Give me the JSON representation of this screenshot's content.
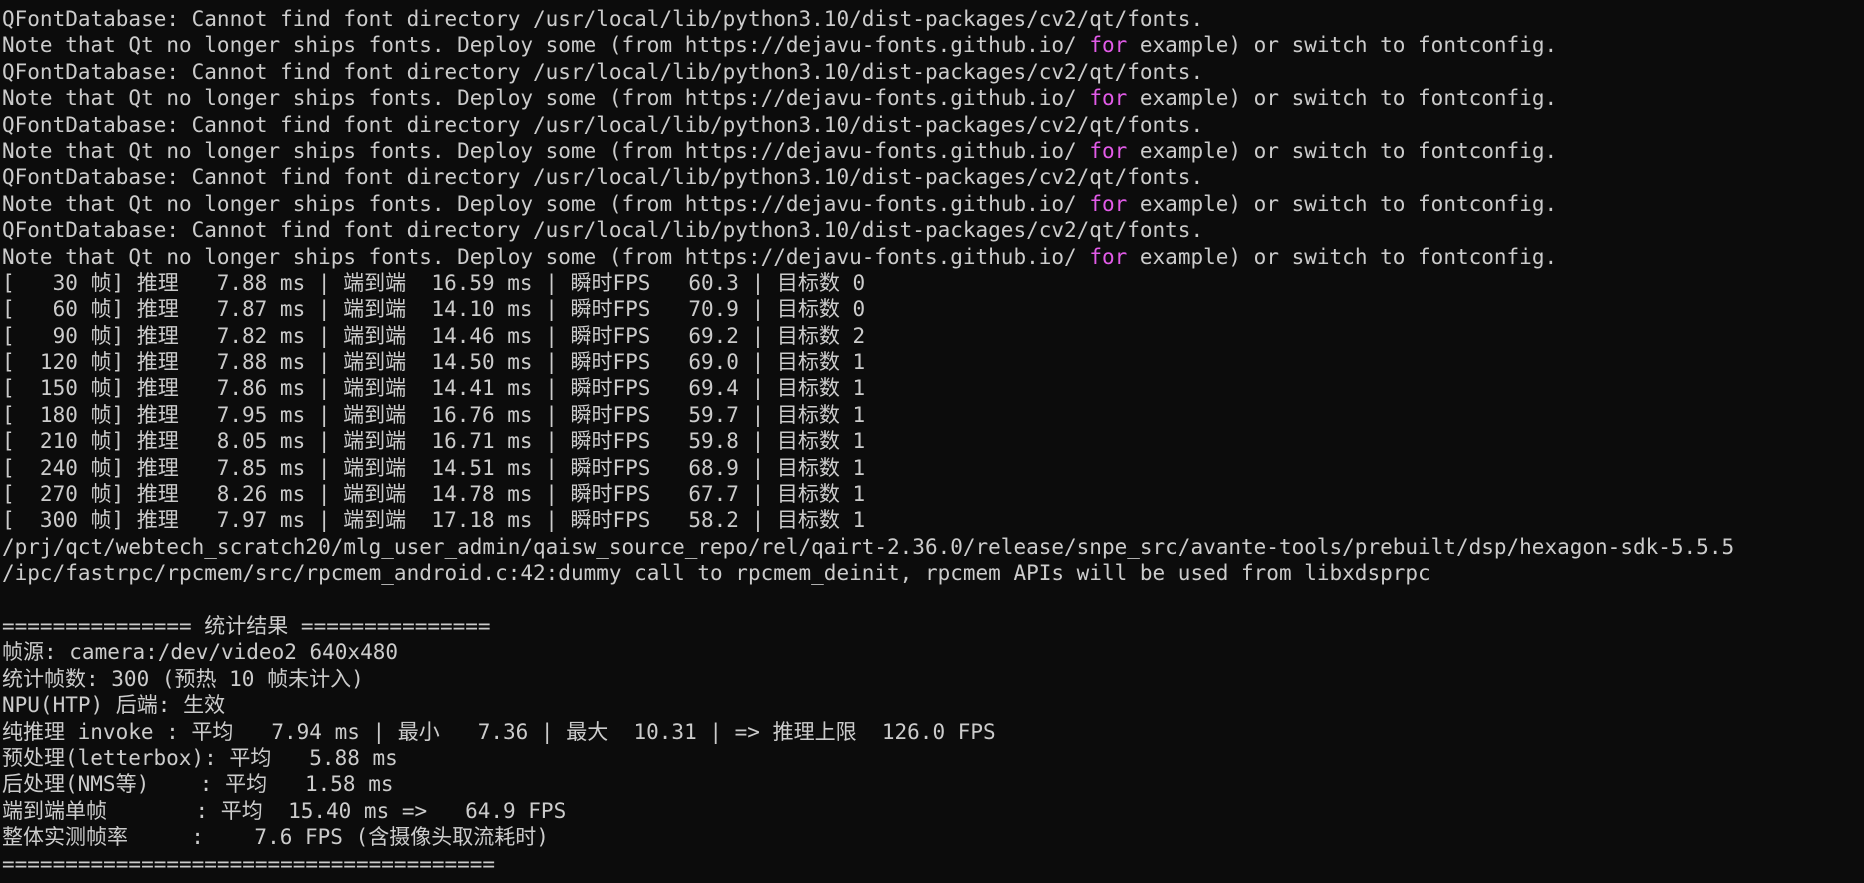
{
  "colors": {
    "background": "#0c0c0c",
    "foreground": "#cccccc",
    "keyword": "#e25be8"
  },
  "lines": [
    [
      {
        "t": "QFontDatabase: Cannot find font directory /usr/local/lib/python3.10/dist-packages/cv2/qt/fonts."
      }
    ],
    [
      {
        "t": "Note that Qt no longer ships fonts. Deploy some (from https://dejavu-fonts.github.io/ "
      },
      {
        "t": "for",
        "c": "kw"
      },
      {
        "t": " example) or switch to fontconfig."
      }
    ],
    [
      {
        "t": "QFontDatabase: Cannot find font directory /usr/local/lib/python3.10/dist-packages/cv2/qt/fonts."
      }
    ],
    [
      {
        "t": "Note that Qt no longer ships fonts. Deploy some (from https://dejavu-fonts.github.io/ "
      },
      {
        "t": "for",
        "c": "kw"
      },
      {
        "t": " example) or switch to fontconfig."
      }
    ],
    [
      {
        "t": "QFontDatabase: Cannot find font directory /usr/local/lib/python3.10/dist-packages/cv2/qt/fonts."
      }
    ],
    [
      {
        "t": "Note that Qt no longer ships fonts. Deploy some (from https://dejavu-fonts.github.io/ "
      },
      {
        "t": "for",
        "c": "kw"
      },
      {
        "t": " example) or switch to fontconfig."
      }
    ],
    [
      {
        "t": "QFontDatabase: Cannot find font directory /usr/local/lib/python3.10/dist-packages/cv2/qt/fonts."
      }
    ],
    [
      {
        "t": "Note that Qt no longer ships fonts. Deploy some (from https://dejavu-fonts.github.io/ "
      },
      {
        "t": "for",
        "c": "kw"
      },
      {
        "t": " example) or switch to fontconfig."
      }
    ],
    [
      {
        "t": "QFontDatabase: Cannot find font directory /usr/local/lib/python3.10/dist-packages/cv2/qt/fonts."
      }
    ],
    [
      {
        "t": "Note that Qt no longer ships fonts. Deploy some (from https://dejavu-fonts.github.io/ "
      },
      {
        "t": "for",
        "c": "kw"
      },
      {
        "t": " example) or switch to fontconfig."
      }
    ],
    [
      {
        "t": "[   30 帧] 推理   7.88 ms | 端到端  16.59 ms | 瞬时FPS   60.3 | 目标数 0"
      }
    ],
    [
      {
        "t": "[   60 帧] 推理   7.87 ms | 端到端  14.10 ms | 瞬时FPS   70.9 | 目标数 0"
      }
    ],
    [
      {
        "t": "[   90 帧] 推理   7.82 ms | 端到端  14.46 ms | 瞬时FPS   69.2 | 目标数 2"
      }
    ],
    [
      {
        "t": "[  120 帧] 推理   7.88 ms | 端到端  14.50 ms | 瞬时FPS   69.0 | 目标数 1"
      }
    ],
    [
      {
        "t": "[  150 帧] 推理   7.86 ms | 端到端  14.41 ms | 瞬时FPS   69.4 | 目标数 1"
      }
    ],
    [
      {
        "t": "[  180 帧] 推理   7.95 ms | 端到端  16.76 ms | 瞬时FPS   59.7 | 目标数 1"
      }
    ],
    [
      {
        "t": "[  210 帧] 推理   8.05 ms | 端到端  16.71 ms | 瞬时FPS   59.8 | 目标数 1"
      }
    ],
    [
      {
        "t": "[  240 帧] 推理   7.85 ms | 端到端  14.51 ms | 瞬时FPS   68.9 | 目标数 1"
      }
    ],
    [
      {
        "t": "[  270 帧] 推理   8.26 ms | 端到端  14.78 ms | 瞬时FPS   67.7 | 目标数 1"
      }
    ],
    [
      {
        "t": "[  300 帧] 推理   7.97 ms | 端到端  17.18 ms | 瞬时FPS   58.2 | 目标数 1"
      }
    ],
    [
      {
        "t": "/prj/qct/webtech_scratch20/mlg_user_admin/qaisw_source_repo/rel/qairt-2.36.0/release/snpe_src/avante-tools/prebuilt/dsp/hexagon-sdk-5.5.5"
      }
    ],
    [
      {
        "t": "/ipc/fastrpc/rpcmem/src/rpcmem_android.c:42:dummy call to rpcmem_deinit, rpcmem APIs will be used from libxdsprpc"
      }
    ],
    [
      {
        "t": ""
      }
    ],
    [
      {
        "t": "=============== 统计结果 ==============="
      }
    ],
    [
      {
        "t": "帧源: camera:/dev/video2 640x480"
      }
    ],
    [
      {
        "t": "统计帧数: 300 (预热 10 帧未计入)"
      }
    ],
    [
      {
        "t": "NPU(HTP) 后端: 生效"
      }
    ],
    [
      {
        "t": "纯推理 invoke : 平均   7.94 ms | 最小   7.36 | 最大  10.31 | => 推理上限  126.0 FPS"
      }
    ],
    [
      {
        "t": "预处理(letterbox): 平均   5.88 ms"
      }
    ],
    [
      {
        "t": "后处理(NMS等)    : 平均   1.58 ms"
      }
    ],
    [
      {
        "t": "端到端单帧       : 平均  15.40 ms =>   64.9 FPS"
      }
    ],
    [
      {
        "t": "整体实测帧率     :    7.6 FPS (含摄像头取流耗时)"
      }
    ],
    [
      {
        "t": "======================================="
      }
    ]
  ]
}
